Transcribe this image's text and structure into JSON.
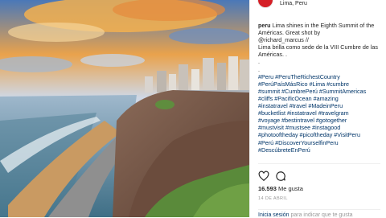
{
  "post": {
    "location": "Lima, Peru"
  },
  "caption": {
    "username": "peru",
    "text_line1": " Lima shines in the Eighth Summit of the Américas. Great shot by",
    "credit": "@richard_marcus",
    "credit_suffix": " //",
    "spanish": "Lima brilla como sede de la VIII Cumbre de las Américas. .",
    "dots": [
      ".",
      "."
    ],
    "hashtags": [
      "#Peru #PeruTheRichestCountry",
      "#PerúPaísMásRico #Lima #cumbre",
      "#summit #CumbrePerú #SummitAmericas",
      "#cliffs #PacificOcean #amazing",
      "#instatravel #travel #MadeinPeru",
      "#bucketlist #instatravel #travelgram",
      "#voyage #bestintravel #gotogether",
      "#mustvisit #mustsee #instagood",
      "#photooftheday #picoftheday #VisitPeru",
      "#Perú #DiscoverYourselfinPeru",
      "#DescúbreteEnPerú"
    ]
  },
  "actions": {
    "like_icon": "heart-icon",
    "comment_icon": "comment-icon"
  },
  "likes": {
    "count": "16.593",
    "label": " Me gusta"
  },
  "date": "14 DE ABRIL",
  "comment_bar": {
    "login_text": "Inicia sesión",
    "rest_text": " para indicar que te gusta"
  },
  "colors": {
    "link": "#003569",
    "text": "#262626",
    "muted": "#999999",
    "avatar": "#d51f26"
  }
}
